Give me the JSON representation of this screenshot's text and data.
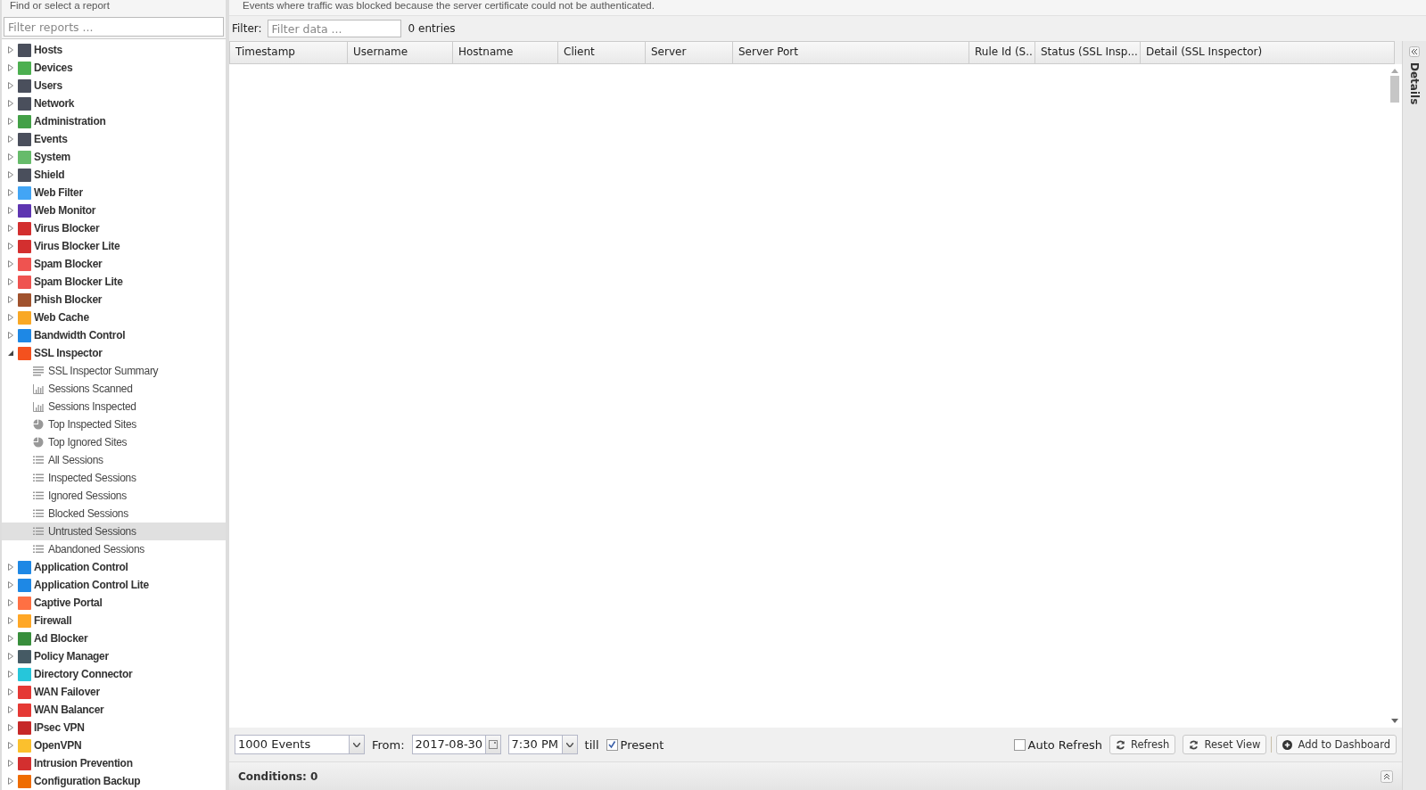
{
  "sidebar": {
    "title": "Find or select a report",
    "filter": {
      "placeholder": "Filter reports ..."
    },
    "items": [
      {
        "label": "Hosts",
        "color": "#4a4f5c",
        "expanded": false
      },
      {
        "label": "Devices",
        "color": "#4caf50",
        "expanded": false
      },
      {
        "label": "Users",
        "color": "#4a4f5c",
        "expanded": false
      },
      {
        "label": "Network",
        "color": "#4a4f5c",
        "expanded": false
      },
      {
        "label": "Administration",
        "color": "#43a047",
        "expanded": false
      },
      {
        "label": "Events",
        "color": "#4a4f5c",
        "expanded": false
      },
      {
        "label": "System",
        "color": "#66bb6a",
        "expanded": false
      },
      {
        "label": "Shield",
        "color": "#4a4f5c",
        "expanded": false
      },
      {
        "label": "Web Filter",
        "color": "#42a5f5",
        "expanded": false
      },
      {
        "label": "Web Monitor",
        "color": "#5e35b1",
        "expanded": false
      },
      {
        "label": "Virus Blocker",
        "color": "#d32f2f",
        "expanded": false
      },
      {
        "label": "Virus Blocker Lite",
        "color": "#d32f2f",
        "expanded": false
      },
      {
        "label": "Spam Blocker",
        "color": "#ef5350",
        "expanded": false
      },
      {
        "label": "Spam Blocker Lite",
        "color": "#ef5350",
        "expanded": false
      },
      {
        "label": "Phish Blocker",
        "color": "#a0522d",
        "expanded": false
      },
      {
        "label": "Web Cache",
        "color": "#f9a825",
        "expanded": false
      },
      {
        "label": "Bandwidth Control",
        "color": "#1e88e5",
        "expanded": false
      },
      {
        "label": "SSL Inspector",
        "color": "#f4511e",
        "expanded": true,
        "children": [
          {
            "label": "SSL Inspector Summary",
            "kind": "summary",
            "selected": false
          },
          {
            "label": "Sessions Scanned",
            "kind": "bar",
            "selected": false
          },
          {
            "label": "Sessions Inspected",
            "kind": "bar",
            "selected": false
          },
          {
            "label": "Top Inspected Sites",
            "kind": "pie",
            "selected": false
          },
          {
            "label": "Top Ignored Sites",
            "kind": "pie",
            "selected": false
          },
          {
            "label": "All Sessions",
            "kind": "list",
            "selected": false
          },
          {
            "label": "Inspected Sessions",
            "kind": "list",
            "selected": false
          },
          {
            "label": "Ignored Sessions",
            "kind": "list",
            "selected": false
          },
          {
            "label": "Blocked Sessions",
            "kind": "list",
            "selected": false
          },
          {
            "label": "Untrusted Sessions",
            "kind": "list",
            "selected": true
          },
          {
            "label": "Abandoned Sessions",
            "kind": "list",
            "selected": false
          }
        ]
      },
      {
        "label": "Application Control",
        "color": "#1e88e5",
        "expanded": false
      },
      {
        "label": "Application Control Lite",
        "color": "#1e88e5",
        "expanded": false
      },
      {
        "label": "Captive Portal",
        "color": "#ff7043",
        "expanded": false
      },
      {
        "label": "Firewall",
        "color": "#ffa726",
        "expanded": false
      },
      {
        "label": "Ad Blocker",
        "color": "#388e3c",
        "expanded": false
      },
      {
        "label": "Policy Manager",
        "color": "#455a64",
        "expanded": false
      },
      {
        "label": "Directory Connector",
        "color": "#26c6da",
        "expanded": false
      },
      {
        "label": "WAN Failover",
        "color": "#e53935",
        "expanded": false
      },
      {
        "label": "WAN Balancer",
        "color": "#e53935",
        "expanded": false
      },
      {
        "label": "IPsec VPN",
        "color": "#c62828",
        "expanded": false
      },
      {
        "label": "OpenVPN",
        "color": "#fbc02d",
        "expanded": false
      },
      {
        "label": "Intrusion Prevention",
        "color": "#d32f2f",
        "expanded": false
      },
      {
        "label": "Configuration Backup",
        "color": "#ef6c00",
        "expanded": false
      }
    ]
  },
  "description": "Events where traffic was blocked because the server certificate could not be authenticated.",
  "filter": {
    "label": "Filter:",
    "placeholder": "Filter data ...",
    "count": "0 entries"
  },
  "table": {
    "columns": [
      "Timestamp",
      "Username",
      "Hostname",
      "Client",
      "Server",
      "Server Port",
      "Rule Id (S..",
      "Status (SSL Insp...",
      "Detail (SSL Inspector)"
    ]
  },
  "details_panel": {
    "title": "Details"
  },
  "toolbar": {
    "limit": "1000 Events",
    "from_label": "From:",
    "date": "2017-08-30",
    "time": "7:30 PM",
    "till_label": "till",
    "present": {
      "label": "Present",
      "checked": true
    },
    "auto_refresh": {
      "label": "Auto Refresh",
      "checked": false
    },
    "buttons": [
      "Refresh",
      "Reset View",
      "Add to Dashboard"
    ]
  },
  "conditions": "Conditions: 0"
}
